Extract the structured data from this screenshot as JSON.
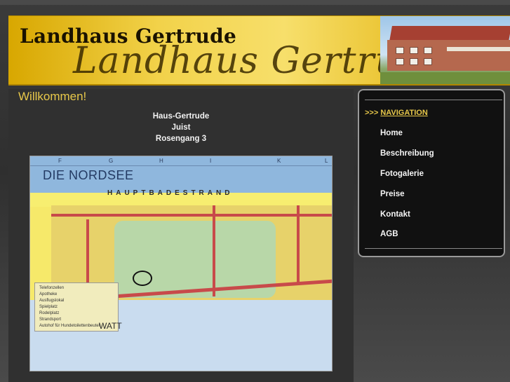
{
  "header": {
    "title": "Landhaus Gertrude",
    "script_title": "Landhaus Gertrude"
  },
  "main": {
    "welcome": "Willkommen!",
    "address": [
      "Haus-Gertrude",
      "Juist",
      "Rosengang 3"
    ],
    "map": {
      "sea_label": "DIE NORDSEE",
      "beach_label": "HAUPTBADESTRAND",
      "watt_label": "WATT",
      "grid_letters": [
        "F",
        "G",
        "H",
        "I",
        "K",
        "L"
      ],
      "legend": [
        "Telefonzellen",
        "Apotheke",
        "Ausflugslokal",
        "Spielplatz",
        "Rodelplatz",
        "Strandsport",
        "Autohof für Hundetoilettenbeutel"
      ]
    }
  },
  "nav": {
    "prefix": ">>>",
    "title": "NAVIGATION",
    "items": [
      "Home",
      "Beschreibung",
      "Fotogalerie",
      "Preise",
      "Kontakt",
      "AGB"
    ]
  },
  "colors": {
    "accent": "#e8c84a",
    "background": "#303030",
    "nav_bg": "#111111"
  }
}
